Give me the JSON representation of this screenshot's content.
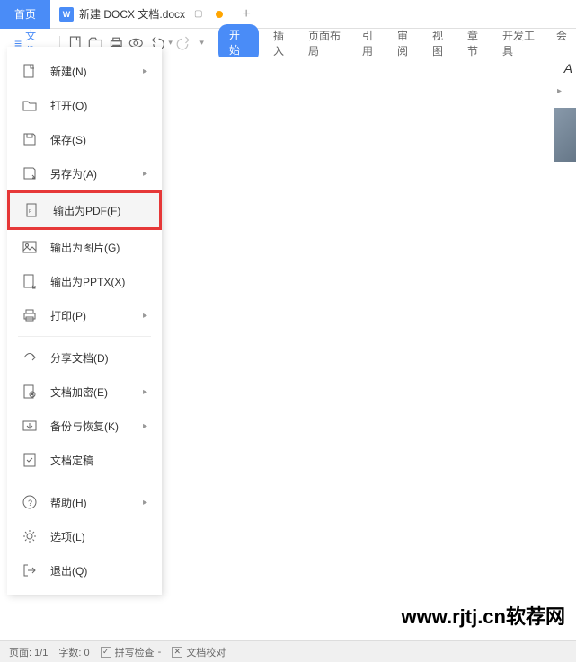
{
  "titlebar": {
    "home": "首页",
    "doc_name": "新建 DOCX 文档.docx",
    "doc_badge": "W"
  },
  "toolbar": {
    "file_label": "文件"
  },
  "ribbon": {
    "tabs": [
      "开始",
      "插入",
      "页面布局",
      "引用",
      "审阅",
      "视图",
      "章节",
      "开发工具",
      "会"
    ]
  },
  "file_menu": {
    "items": [
      {
        "icon": "new",
        "label": "新建(N)",
        "arrow": true
      },
      {
        "icon": "open",
        "label": "打开(O)"
      },
      {
        "icon": "save",
        "label": "保存(S)"
      },
      {
        "icon": "saveas",
        "label": "另存为(A)",
        "arrow": true
      },
      {
        "icon": "pdf",
        "label": "输出为PDF(F)",
        "highlighted": true
      },
      {
        "icon": "image",
        "label": "输出为图片(G)"
      },
      {
        "icon": "pptx",
        "label": "输出为PPTX(X)"
      },
      {
        "icon": "print",
        "label": "打印(P)",
        "arrow": true
      },
      {
        "icon": "share",
        "label": "分享文档(D)"
      },
      {
        "icon": "encrypt",
        "label": "文档加密(E)",
        "arrow": true
      },
      {
        "icon": "backup",
        "label": "备份与恢复(K)",
        "arrow": true
      },
      {
        "icon": "finalize",
        "label": "文档定稿"
      },
      {
        "icon": "help",
        "label": "帮助(H)",
        "arrow": true
      },
      {
        "icon": "options",
        "label": "选项(L)"
      },
      {
        "icon": "exit",
        "label": "退出(Q)"
      }
    ]
  },
  "side": {
    "a": "A"
  },
  "watermark": "www.rjtj.cn软荐网",
  "statusbar": {
    "page": "页面: 1/1",
    "words": "字数: 0",
    "spell": "拼写检查",
    "proof": "文档校对",
    "dash": "-"
  }
}
